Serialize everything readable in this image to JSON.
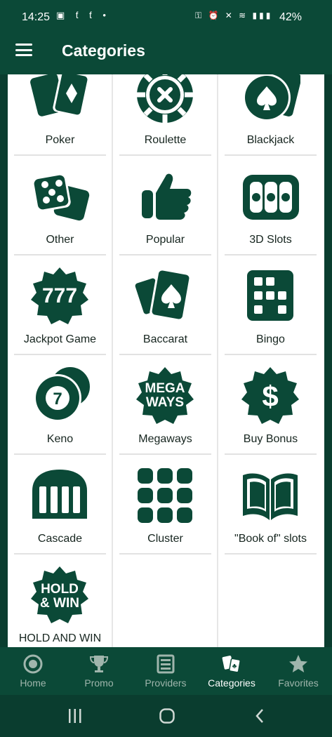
{
  "status_bar": {
    "time": "14:25",
    "battery": "42%",
    "left_icons": [
      "gallery-icon",
      "app-icon",
      "app-icon",
      "dot"
    ],
    "right_icons": [
      "key-icon",
      "alarm-icon",
      "mute-icon",
      "wifi-icon",
      "volte-icon",
      "signal-icon"
    ]
  },
  "header": {
    "title": "Categories",
    "menu_icon": "hamburger-icon"
  },
  "categories": [
    {
      "label": "Poker",
      "icon": "cards-diamond-icon"
    },
    {
      "label": "Roulette",
      "icon": "roulette-chip-icon"
    },
    {
      "label": "Blackjack",
      "icon": "blackjack-cards-icon"
    },
    {
      "label": "Other",
      "icon": "dice-icon"
    },
    {
      "label": "Popular",
      "icon": "thumbs-up-icon"
    },
    {
      "label": "3D Slots",
      "icon": "slot-machine-icon"
    },
    {
      "label": "Jackpot Game",
      "icon": "jackpot-777-icon"
    },
    {
      "label": "Baccarat",
      "icon": "baccarat-cards-icon"
    },
    {
      "label": "Bingo",
      "icon": "bingo-grid-icon"
    },
    {
      "label": "Keno",
      "icon": "keno-ball-icon"
    },
    {
      "label": "Megaways",
      "icon": "megaways-badge-icon"
    },
    {
      "label": "Buy Bonus",
      "icon": "dollar-badge-icon"
    },
    {
      "label": "Cascade",
      "icon": "cascade-reels-icon"
    },
    {
      "label": "Cluster",
      "icon": "cluster-grid-icon"
    },
    {
      "label": "\"Book of\" slots",
      "icon": "open-book-icon"
    },
    {
      "label": "HOLD AND WIN",
      "icon": "hold-win-badge-icon"
    }
  ],
  "badges": {
    "jackpot": "777",
    "megaways": [
      "MEGA",
      "WAYS"
    ],
    "dollar": "$",
    "keno": "7",
    "holdwin": [
      "HOLD",
      "& WIN"
    ]
  },
  "bottom_nav": [
    {
      "label": "Home",
      "icon": "home-chip-icon",
      "active": false
    },
    {
      "label": "Promo",
      "icon": "trophy-icon",
      "active": false
    },
    {
      "label": "Providers",
      "icon": "providers-list-icon",
      "active": false
    },
    {
      "label": "Categories",
      "icon": "cards-icon",
      "active": true
    },
    {
      "label": "Favorites",
      "icon": "star-icon",
      "active": false
    }
  ],
  "system_nav": [
    "recents-button",
    "home-button",
    "back-button"
  ],
  "colors": {
    "primary": "#0b4937",
    "icon": "#0b4937",
    "inactive_nav": "#9fb5ac",
    "active_nav": "#ffffff"
  }
}
